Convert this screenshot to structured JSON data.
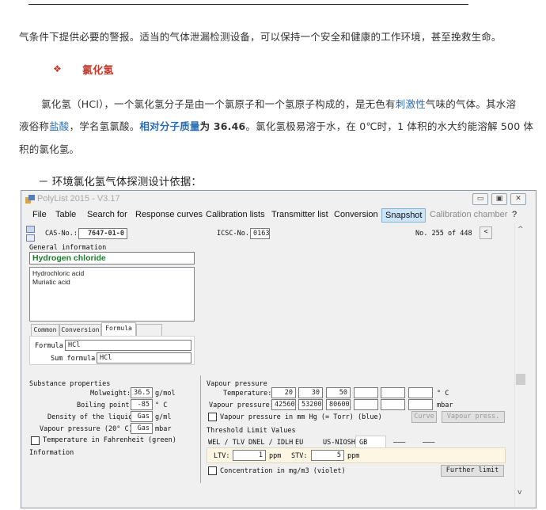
{
  "document": {
    "para1": "气条件下提供必要的警报。适当的气体泄漏检测设备，可以保持一个安全和健康的工作环境，甚至挽救生命。",
    "bullet": "❖",
    "heading": "氯化氢",
    "para2": {
      "l1_a": "氯化氢（HCl），一个氯化氢分子是由一个氯原子和一个氢原子构成的，是无色有",
      "l1_link": "刺激性",
      "l1_b": "气味的气体。其水溶",
      "l2_a": "液俗称",
      "l2_link": "盐酸",
      "l2_b": "，学名氢氯酸。",
      "l2_boldlink": "相对分子质量",
      "l2_bold": "为 36.46",
      "l2_c": "。氯化氢极易溶于水，在 0℃时，1 体积的水大约能溶解 500 体",
      "l3": "积的氯化氢。"
    },
    "subheading": "－  环境氯化氢气体探测设计依据："
  },
  "window": {
    "title": "PolyList 2015 - V3.17",
    "controls": {
      "min": "▭",
      "max": "▣",
      "close": "✕"
    },
    "menu": [
      "File",
      "Table",
      "Search for",
      "Response curves",
      "Calibration lists",
      "Transmitter list",
      "Conversion",
      "Snapshot",
      "Calibration chamber",
      "?"
    ],
    "cas_label": "CAS-No.:",
    "cas_value": "7647-01-0",
    "icsc_label": "ICSC-No.",
    "icsc_value": "0163",
    "record": "No. 255 of 448",
    "prev_btn": "<",
    "general_info_label": "General information",
    "name": "Hydrogen chloride",
    "synonyms": [
      "Hydrochloric acid",
      "Muriatic acid"
    ],
    "tabs": [
      "Common",
      "Conversion",
      "Formula"
    ],
    "formula_label": "Formula",
    "formula_value": "HCl",
    "sum_formula_label": "Sum formula:",
    "sum_formula_value": "HCl",
    "substance_label": "Substance properties",
    "molweight_label": "Molweight:",
    "molweight_value": "36.5",
    "molweight_unit": "g/mol",
    "boiling_label": "Boiling point:",
    "boiling_value": "-85",
    "boiling_unit": "° C",
    "density_label": "Density of the liquid:",
    "density_value": "Gas",
    "density_unit": "g/ml",
    "vp20_label": "Vapour pressure (20° C):",
    "vp20_value": "Gas",
    "vp20_unit": "mbar",
    "fahrenheit_label": "Temperature in Fahrenheit (green)",
    "information_label": "Information",
    "vapour_label": "Vapour pressure",
    "temperature_label": "Temperature:",
    "temperatures": [
      "20",
      "30",
      "50",
      "",
      "",
      ""
    ],
    "temp_unit": "° C",
    "vpressure_label": "Vapour pressure:",
    "pressures": [
      "42560",
      "53200",
      "80600",
      "",
      "",
      ""
    ],
    "pressure_unit": "mbar",
    "mmhg_label": "Vapour pressure in mm Hg (= Torr) (blue)",
    "curve_btn": "Curve",
    "vapour_press_btn": "Vapour press.",
    "tlv_label": "Threshold Limit Values",
    "tlv_tabs": [
      "WEL / TLV",
      "DNEL / IDLH",
      "EU",
      "US-NIOSH",
      "GB",
      "———",
      "———"
    ],
    "ltv_label": "LTV:",
    "ltv_value": "1",
    "ltv_unit": "ppm",
    "stv_label": "STV:",
    "stv_value": "5",
    "stv_unit": "ppm",
    "concentration_label": "Concentration in mg/m3 (violet)",
    "further_limit_btn": "Further limit",
    "scroll_up": "^",
    "scroll_down": "v"
  }
}
